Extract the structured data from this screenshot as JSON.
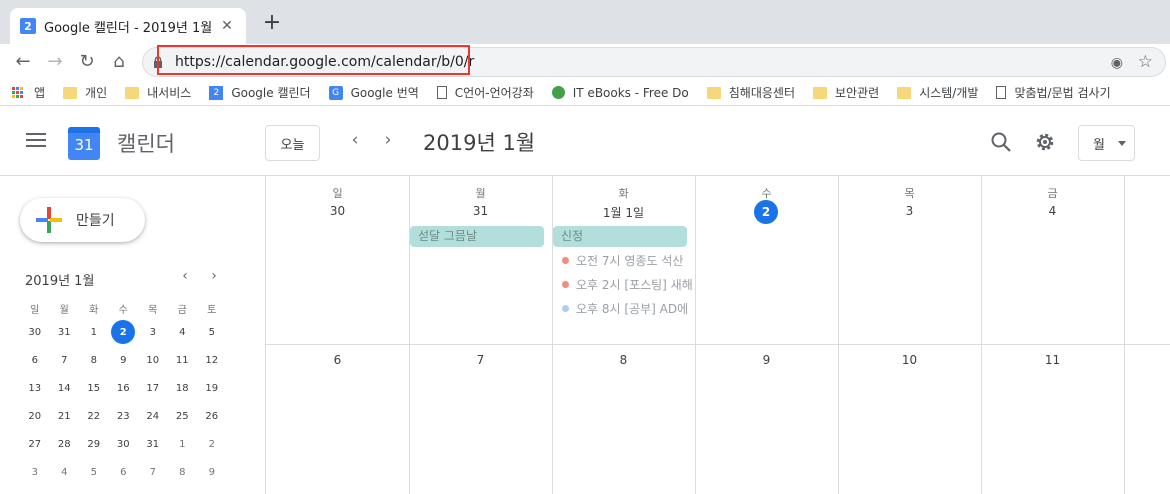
{
  "browser": {
    "tab_title": "Google 캘린더 - 2019년 1월",
    "tab_favicon_text": "2",
    "new_tab_label": "+",
    "url": "https://calendar.google.com/calendar/b/0/r",
    "highlight_color": "#e53935"
  },
  "bookmarks": [
    {
      "label": "앱",
      "icon": "apps-grid-icon"
    },
    {
      "label": "개인",
      "icon": "folder-icon"
    },
    {
      "label": "내서비스",
      "icon": "folder-icon"
    },
    {
      "label": "Google 캘린더",
      "icon": "google-calendar-icon"
    },
    {
      "label": "Google 번역",
      "icon": "google-translate-icon"
    },
    {
      "label": "C언어-언어강좌",
      "icon": "page-icon"
    },
    {
      "label": "IT eBooks - Free Do",
      "icon": "green-ball-icon"
    },
    {
      "label": "침해대응센터",
      "icon": "folder-icon"
    },
    {
      "label": "보안관련",
      "icon": "folder-icon"
    },
    {
      "label": "시스템/개발",
      "icon": "folder-icon"
    },
    {
      "label": "맞춤법/문법 검사기",
      "icon": "page-icon"
    }
  ],
  "header": {
    "logo_text": "31",
    "app_name": "캘린더",
    "today_label": "오늘",
    "prev_label": "‹",
    "next_label": "›",
    "month_title": "2019년 1월",
    "view_label": "월"
  },
  "sidebar": {
    "create_label": "만들기",
    "mini_title": "2019년 1월",
    "weekdays": [
      "일",
      "월",
      "화",
      "수",
      "목",
      "금",
      "토"
    ],
    "weeks": [
      [
        "30",
        "31",
        "1",
        "2",
        "3",
        "4",
        "5"
      ],
      [
        "6",
        "7",
        "8",
        "9",
        "10",
        "11",
        "12"
      ],
      [
        "13",
        "14",
        "15",
        "16",
        "17",
        "18",
        "19"
      ],
      [
        "20",
        "21",
        "22",
        "23",
        "24",
        "25",
        "26"
      ],
      [
        "27",
        "28",
        "29",
        "30",
        "31",
        "1",
        "2"
      ],
      [
        "3",
        "4",
        "5",
        "6",
        "7",
        "8",
        "9"
      ]
    ]
  },
  "month_grid": {
    "weekdays": [
      "일",
      "월",
      "화",
      "수",
      "목",
      "금"
    ],
    "week1_days": [
      "30",
      "31",
      "1월 1일",
      "2",
      "3",
      "4"
    ],
    "week2_days": [
      "6",
      "7",
      "8",
      "9",
      "10",
      "11"
    ],
    "allday_events": [
      {
        "label": "섣달 그믐날",
        "color": "#b2dfdb"
      },
      {
        "label": "신정",
        "color": "#b2dfdb"
      }
    ],
    "timed_events": [
      {
        "label": "오전 7시 영종도 석산",
        "color": "#f28b82"
      },
      {
        "label": "오후 2시 [포스팅] 새해",
        "color": "#f28b82"
      },
      {
        "label": "오후 8시 [공부] AD에",
        "color": "#aecbfa"
      }
    ]
  },
  "colors": {
    "accent": "#1a73e8",
    "event_teal": "#b2dfdb"
  }
}
